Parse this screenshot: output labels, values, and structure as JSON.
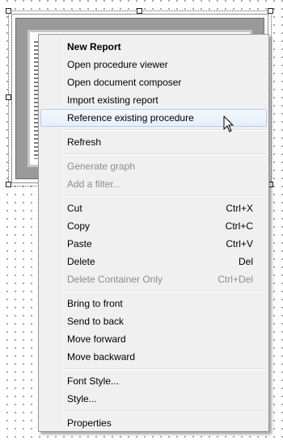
{
  "menu": {
    "items": [
      {
        "label": "New Report",
        "shortcut": ""
      },
      {
        "label": "Open procedure viewer",
        "shortcut": ""
      },
      {
        "label": "Open document composer",
        "shortcut": ""
      },
      {
        "label": "Import existing report",
        "shortcut": ""
      },
      {
        "label": "Reference existing procedure",
        "shortcut": ""
      },
      {
        "label": "Refresh",
        "shortcut": ""
      },
      {
        "label": "Generate graph",
        "shortcut": ""
      },
      {
        "label": "Add a filter...",
        "shortcut": ""
      },
      {
        "label": "Cut",
        "shortcut": "Ctrl+X"
      },
      {
        "label": "Copy",
        "shortcut": "Ctrl+C"
      },
      {
        "label": "Paste",
        "shortcut": "Ctrl+V"
      },
      {
        "label": "Delete",
        "shortcut": "Del"
      },
      {
        "label": "Delete Container Only",
        "shortcut": "Ctrl+Del"
      },
      {
        "label": "Bring to front",
        "shortcut": ""
      },
      {
        "label": "Send to back",
        "shortcut": ""
      },
      {
        "label": "Move forward",
        "shortcut": ""
      },
      {
        "label": "Move backward",
        "shortcut": ""
      },
      {
        "label": "Font Style...",
        "shortcut": ""
      },
      {
        "label": "Style...",
        "shortcut": ""
      },
      {
        "label": "Properties",
        "shortcut": ""
      }
    ],
    "hovered_item": "Reference existing procedure",
    "disabled_items": [
      "Generate graph",
      "Add a filter...",
      "Delete Container Only"
    ]
  },
  "colors": {
    "menu_bg": "#f0f0f0",
    "hover_border": "#aecff7",
    "disabled_text": "#8d8d8d"
  },
  "icons": {
    "cursor": "arrow-cursor-icon"
  }
}
